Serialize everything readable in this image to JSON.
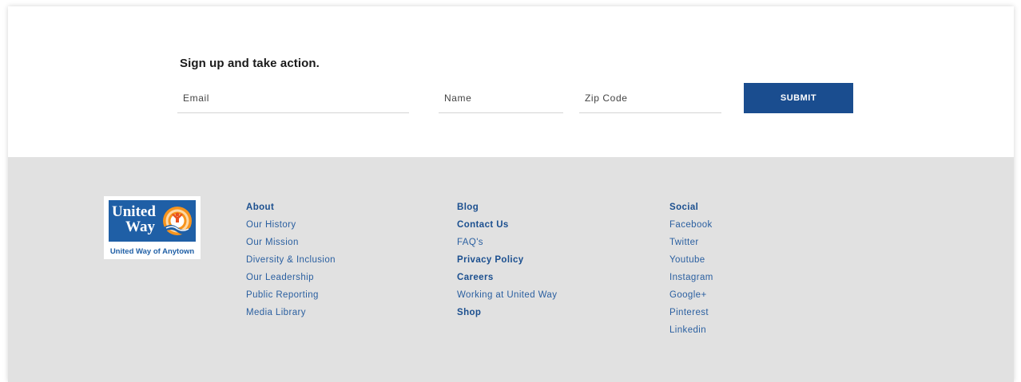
{
  "signup": {
    "title": "Sign up and take action.",
    "email_placeholder": "Email",
    "name_placeholder": "Name",
    "zip_placeholder": "Zip Code",
    "submit_label": "SUBMIT"
  },
  "footer": {
    "logo": {
      "word1": "United",
      "word2": "Way",
      "caption": "United Way of Anytown"
    },
    "columns": [
      {
        "items": [
          {
            "label": "About",
            "bold": true
          },
          {
            "label": "Our History",
            "bold": false
          },
          {
            "label": "Our Mission",
            "bold": false
          },
          {
            "label": "Diversity & Inclusion",
            "bold": false
          },
          {
            "label": "Our Leadership",
            "bold": false
          },
          {
            "label": "Public Reporting",
            "bold": false
          },
          {
            "label": "Media Library",
            "bold": false
          }
        ]
      },
      {
        "items": [
          {
            "label": "Blog",
            "bold": true
          },
          {
            "label": "Contact Us",
            "bold": true
          },
          {
            "label": "FAQ's",
            "bold": false
          },
          {
            "label": "Privacy Policy",
            "bold": true
          },
          {
            "label": "Careers",
            "bold": true
          },
          {
            "label": "Working at United Way",
            "bold": false
          },
          {
            "label": "Shop",
            "bold": true
          }
        ]
      },
      {
        "items": [
          {
            "label": "Social",
            "bold": true
          },
          {
            "label": "Facebook",
            "bold": false
          },
          {
            "label": "Twitter",
            "bold": false
          },
          {
            "label": "Youtube",
            "bold": false
          },
          {
            "label": "Instagram",
            "bold": false
          },
          {
            "label": "Google+",
            "bold": false
          },
          {
            "label": "Pinterest",
            "bold": false
          },
          {
            "label": "Linkedin",
            "bold": false
          }
        ]
      }
    ]
  },
  "colors": {
    "brand_blue": "#1f5fa6",
    "submit_bg": "#1a4d8f",
    "footer_bg": "#e1e1e1",
    "link": "#2a5fa0"
  }
}
